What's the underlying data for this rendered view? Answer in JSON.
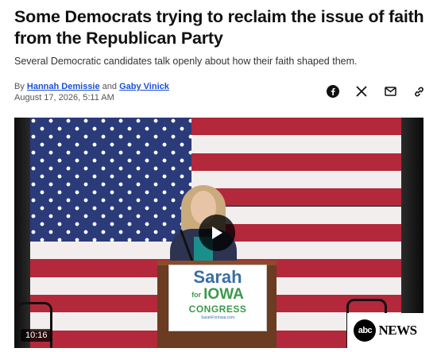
{
  "article": {
    "headline": "Some Democrats trying to reclaim the issue of faith from the Republican Party",
    "subheadline": "Several Democratic candidates talk openly about how their faith shaped them.",
    "byline_prefix": "By",
    "authors": [
      "Hannah Demissie",
      "Gaby Vinick"
    ],
    "author_separator": "and",
    "date": "August 17, 2026, 5:11 AM"
  },
  "share": {
    "icons": [
      "facebook-icon",
      "x-icon",
      "mail-icon",
      "link-icon"
    ]
  },
  "video": {
    "duration": "10:16",
    "sign": {
      "name": "Sarah",
      "for": "for",
      "state": "IOWA",
      "office": "CONGRESS",
      "site": "SarahForIowa.com"
    },
    "brand": {
      "logo": "abc",
      "label": "NEWS"
    }
  },
  "colors": {
    "link": "#1a4fd6",
    "flag_red": "#b3283a",
    "flag_blue": "#2b3a78",
    "sign_blue": "#3a6ea5",
    "sign_green": "#3b9a4a"
  }
}
